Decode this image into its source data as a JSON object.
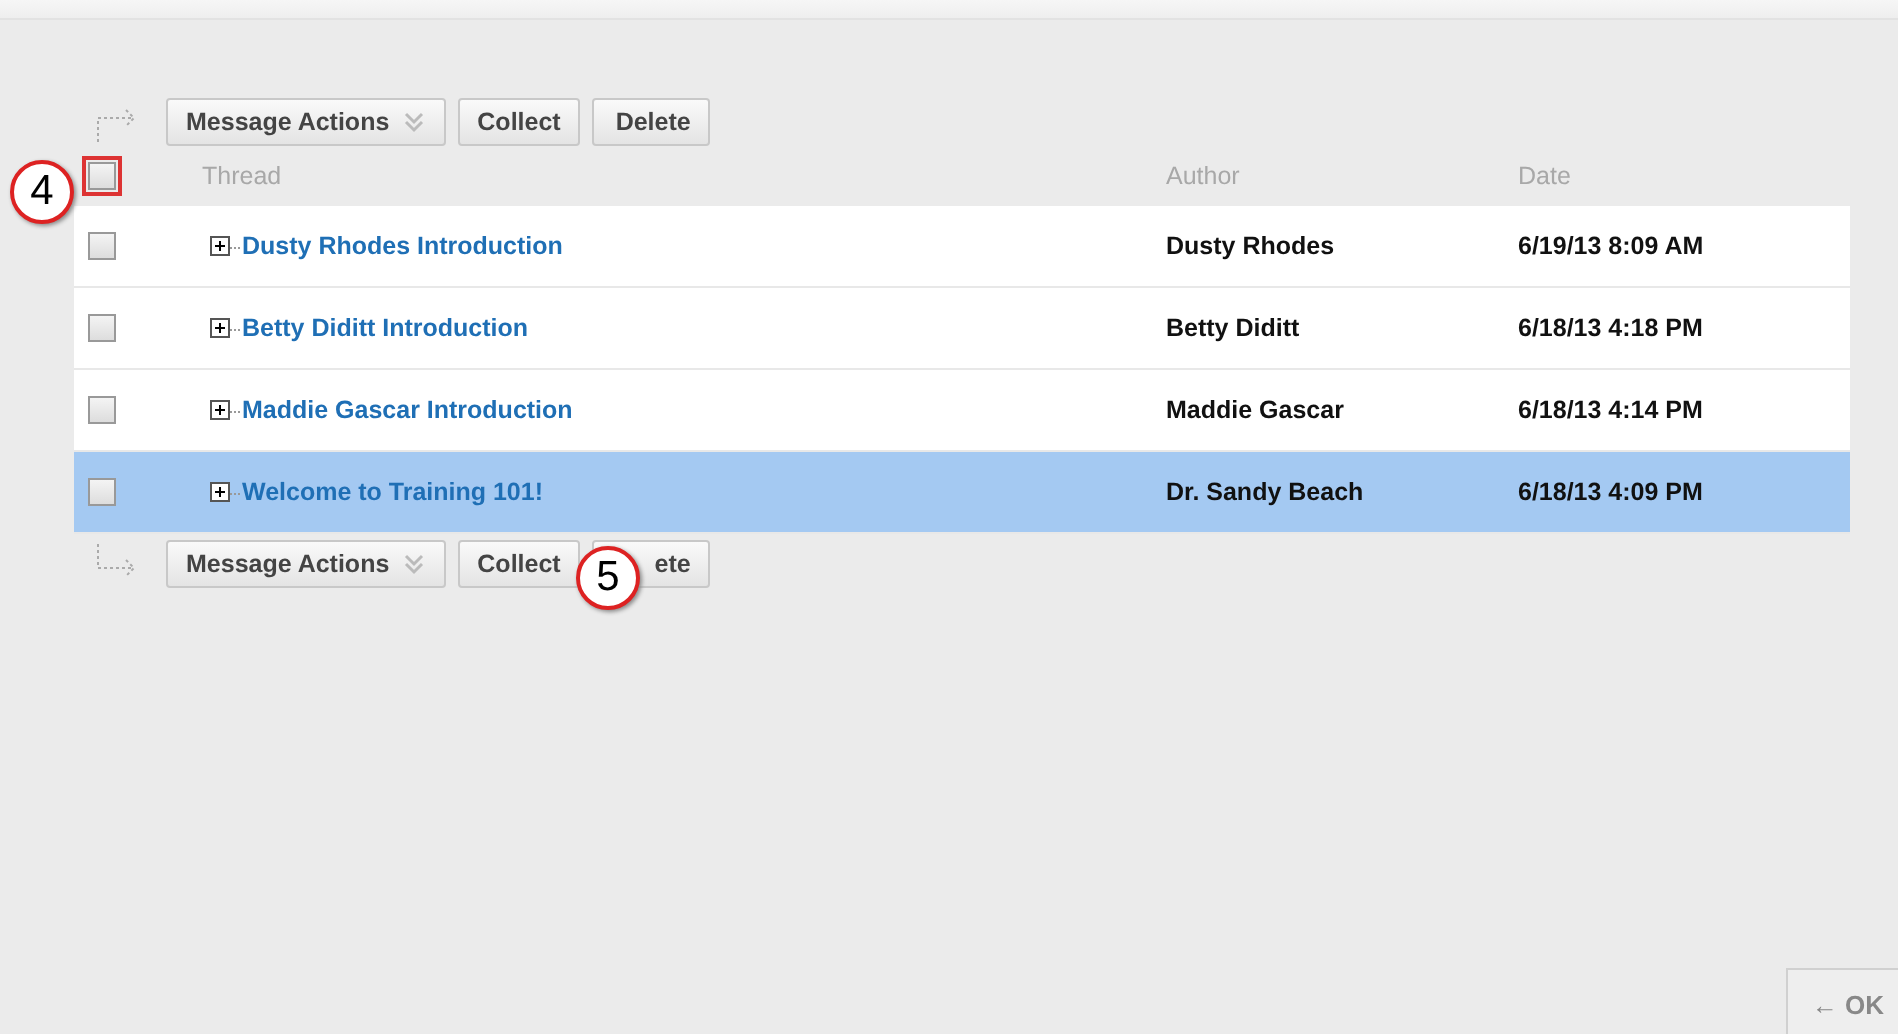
{
  "toolbars": [
    {
      "buttons": [
        {
          "label": "Message Actions",
          "kind": "menu"
        },
        {
          "label": "Collect",
          "kind": "plain"
        },
        {
          "label": "Delete",
          "kind": "plain"
        }
      ]
    },
    {
      "buttons": [
        {
          "label": "Message Actions",
          "kind": "menu"
        },
        {
          "label": "Collect",
          "kind": "plain"
        },
        {
          "label": "ete",
          "kind": "plain"
        }
      ]
    }
  ],
  "table": {
    "select_all": {
      "checked": false,
      "highlighted": true
    },
    "columns": [
      "Thread",
      "Author",
      "Date"
    ],
    "rows": [
      {
        "thread": "Dusty Rhodes Introduction",
        "author": "Dusty Rhodes",
        "date": "6/19/13 8:09 AM",
        "checked": false,
        "selected": false
      },
      {
        "thread": "Betty Diditt Introduction",
        "author": "Betty Diditt",
        "date": "6/18/13 4:18 PM",
        "checked": false,
        "selected": false
      },
      {
        "thread": "Maddie Gascar Introduction",
        "author": "Maddie Gascar",
        "date": "6/18/13 4:14 PM",
        "checked": false,
        "selected": false
      },
      {
        "thread": "Welcome to Training 101!",
        "author": "Dr. Sandy Beach",
        "date": "6/18/13 4:09 PM",
        "checked": false,
        "selected": true
      }
    ]
  },
  "callouts": [
    {
      "label": "4"
    },
    {
      "label": "5"
    }
  ],
  "footer": {
    "button": "← OK"
  }
}
